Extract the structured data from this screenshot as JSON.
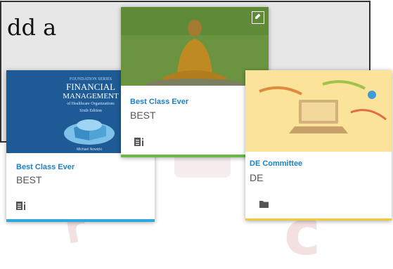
{
  "panel": {
    "text": "dd a"
  },
  "cards": [
    {
      "title": "Best Class Ever",
      "code": "BEST",
      "cover_text_1": "FINANCIAL",
      "cover_text_2": "MANAGEMENT",
      "cover_text_3": "of Healthcare Organizations",
      "cover_text_4": "Sixth Edition",
      "cover_author": "Michael Nowicki",
      "footer_icon": "document-list-icon"
    },
    {
      "title": "Best Class Ever",
      "code": "BEST",
      "footer_icon": "document-list-icon",
      "corner_icon": "edit-icon"
    },
    {
      "title": "DE Committee",
      "code": "DE",
      "footer_icon": "folder-icon"
    }
  ],
  "colors": {
    "title": "#1d7fc4",
    "panel_bg": "#e7e7e7",
    "card1_bar": "#2fa8e0",
    "card2_bar": "#6cb64a",
    "card3_bar": "#f2c93a"
  }
}
